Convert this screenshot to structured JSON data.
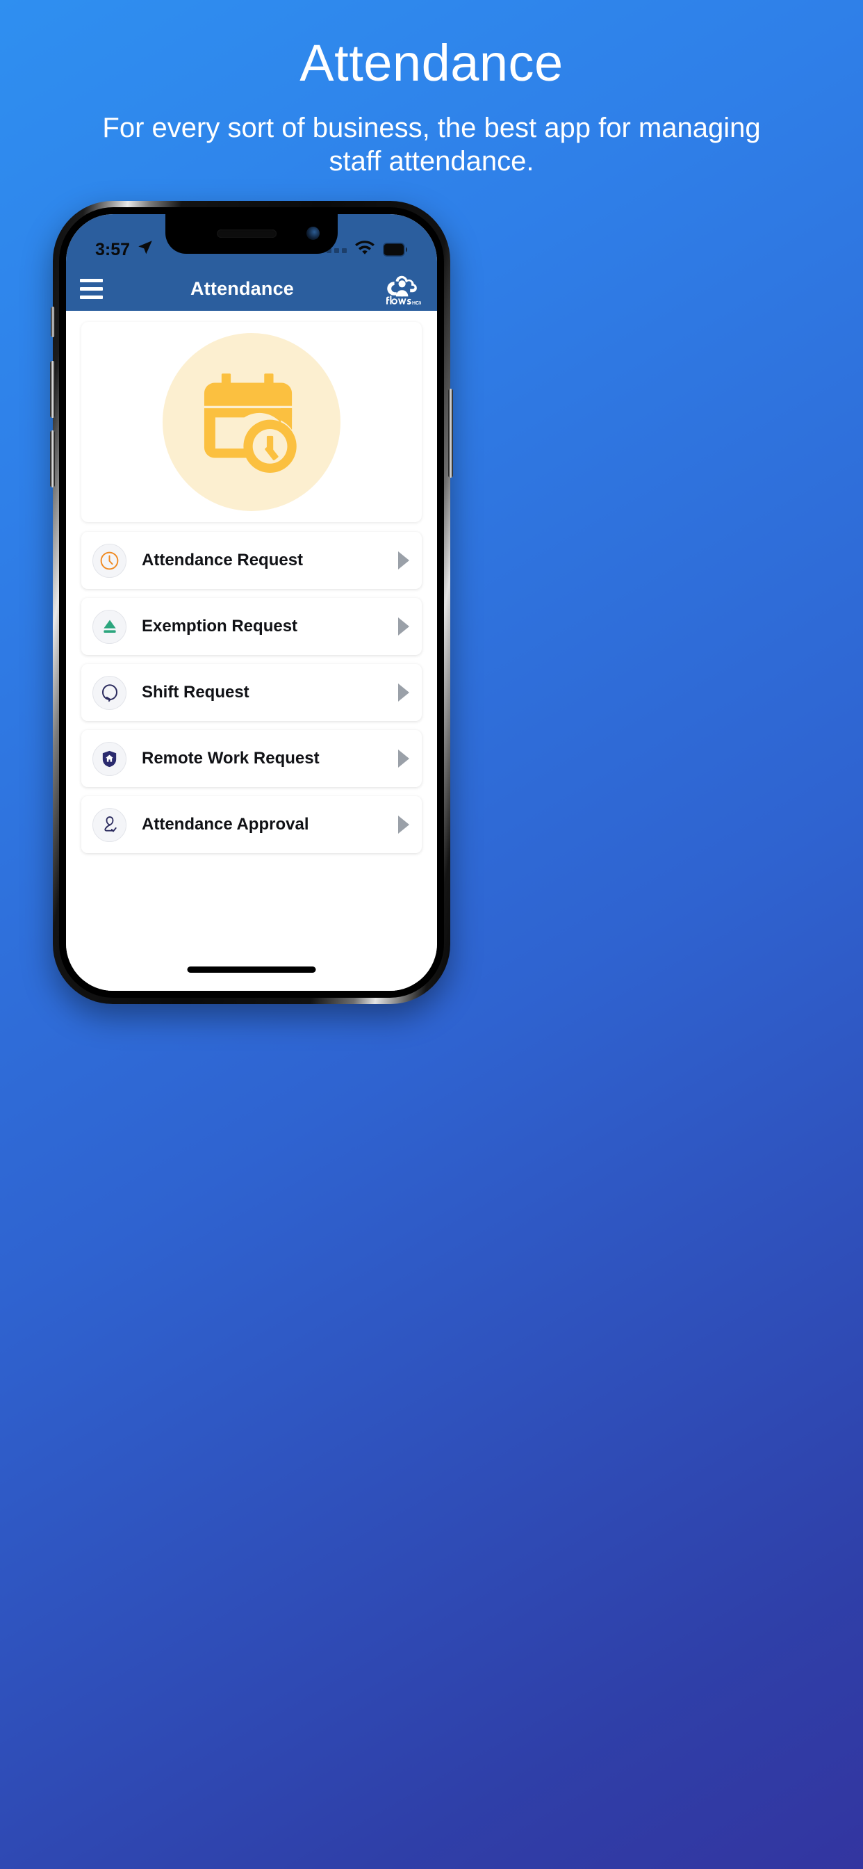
{
  "promo": {
    "title": "Attendance",
    "subtitle": "For every sort of business, the best app for managing staff attendance."
  },
  "phone": {
    "status_bar": {
      "time": "3:57",
      "location_icon": "location-arrow-icon",
      "signal_icon": "signal-dots-icon",
      "wifi_icon": "wifi-icon",
      "battery_icon": "battery-full-icon"
    },
    "app_bar": {
      "menu_icon": "hamburger-menu-icon",
      "title": "Attendance",
      "brand_name": "flows",
      "brand_suffix": "HCM",
      "brand_icon": "cloud-person-logo-icon"
    },
    "hero": {
      "icon": "calendar-clock-icon",
      "icon_color": "#FBC040",
      "circle_color": "#FCEFD0"
    },
    "menu_items": [
      {
        "label": "Attendance Request",
        "icon": "clock-icon",
        "icon_color": "#F08A22",
        "chevron": "chevron-right-icon"
      },
      {
        "label": "Exemption Request",
        "icon": "eject-triangle-icon",
        "icon_color": "#2CA67E",
        "chevron": "chevron-right-icon"
      },
      {
        "label": "Shift Request",
        "icon": "refresh-loop-icon",
        "icon_color": "#2B2B5E",
        "chevron": "chevron-right-icon"
      },
      {
        "label": "Remote Work Request",
        "icon": "shield-home-icon",
        "icon_color": "#2B2B6E",
        "chevron": "chevron-right-icon"
      },
      {
        "label": "Attendance Approval",
        "icon": "user-check-icon",
        "icon_color": "#2B2B5E",
        "chevron": "chevron-right-icon"
      }
    ],
    "home_indicator": "home-indicator-bar"
  },
  "colors": {
    "background_start": "#2F8FF0",
    "background_end": "#3335A0",
    "app_bar": "#2B5E9E",
    "accent_yellow": "#FBC040"
  }
}
